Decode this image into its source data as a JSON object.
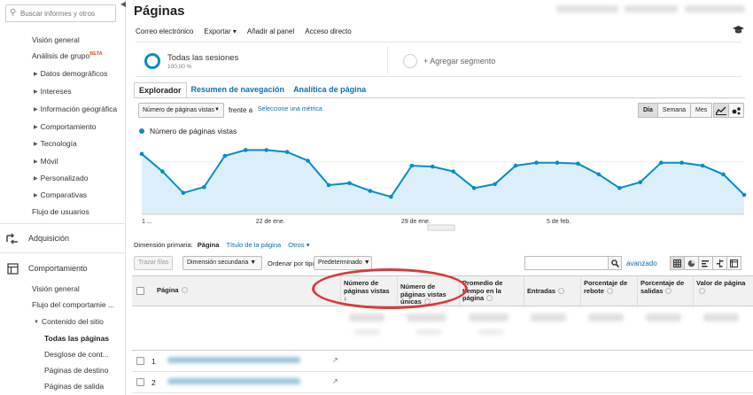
{
  "sidebar": {
    "search_placeholder": "Buscar informes y otros",
    "items": [
      {
        "label": "Visión general",
        "indent": 1
      },
      {
        "label": "Análisis de grupo",
        "badge": "BETA",
        "indent": 1
      },
      {
        "label": "Datos demográficos",
        "indent": 2,
        "expandable": true
      },
      {
        "label": "Intereses",
        "indent": 2,
        "expandable": true
      },
      {
        "label": "Información geográfica",
        "indent": 2,
        "expandable": true
      },
      {
        "label": "Comportamiento",
        "indent": 2,
        "expandable": true
      },
      {
        "label": "Tecnología",
        "indent": 2,
        "expandable": true
      },
      {
        "label": "Móvil",
        "indent": 2,
        "expandable": true
      },
      {
        "label": "Personalizado",
        "indent": 2,
        "expandable": true
      },
      {
        "label": "Comparativas",
        "indent": 2,
        "expandable": true
      },
      {
        "label": "Flujo de usuarios",
        "indent": 1
      }
    ],
    "section_adquisicion": "Adquisición",
    "section_comportamiento": "Comportamiento",
    "comportamiento_items": [
      {
        "label": "Visión general"
      },
      {
        "label": "Flujo del comportamie ..."
      },
      {
        "label": "Contenido del sitio",
        "expanded": true
      },
      {
        "label": "Todas las páginas",
        "active": true
      },
      {
        "label": "Desglose de cont..."
      },
      {
        "label": "Páginas de destino"
      },
      {
        "label": "Páginas de salida"
      }
    ]
  },
  "header": {
    "title": "Páginas",
    "toolbar": [
      "Correo electrónico",
      "Exportar",
      "Añadir al panel",
      "Acceso directo"
    ]
  },
  "segments": {
    "all_sessions": "Todas las sesiones",
    "all_sessions_pct": "100,00 %",
    "add_segment": "+ Agregar segmento"
  },
  "tabs": [
    "Explorador",
    "Resumen de navegación",
    "Analítica de página"
  ],
  "controls": {
    "metric": "Número de páginas vistas",
    "vs": "frente a",
    "compare_link": "Seleccione una métrica",
    "periods": [
      "Día",
      "Semana",
      "Mes"
    ],
    "active_period": "Día"
  },
  "chart_data": {
    "type": "area",
    "series": [
      {
        "name": "Número de páginas vistas",
        "values": [
          62,
          44,
          22,
          28,
          60,
          66,
          66,
          64,
          55,
          30,
          32,
          24,
          18,
          50,
          49,
          44,
          27,
          31,
          50,
          53,
          53,
          52,
          41,
          27,
          33,
          53,
          53,
          50,
          41,
          20
        ]
      }
    ],
    "x_tick_labels": [
      "1 ...",
      "22 de ene.",
      "29 de ene.",
      "5 de feb."
    ],
    "color": "#058dc7",
    "fill": "#dbeef9"
  },
  "dimension": {
    "label": "Dimensión primaria:",
    "current": "Página",
    "options": [
      "Título de la página",
      "Otros"
    ]
  },
  "table_controls": {
    "plot_rows": "Trazar filas",
    "secondary": "Dimensión secundaria",
    "sort_label": "Ordenar por tipo:",
    "sort_value": "Predeterminado",
    "advanced": "avanzado"
  },
  "table": {
    "headers": [
      "Página",
      "Número de páginas vistas",
      "Número de páginas vistas únicas",
      "Promedio de tiempo en la página",
      "Entradas",
      "Porcentaje de rebote",
      "Porcentaje de salidas",
      "Valor de página"
    ],
    "rows": [
      "1",
      "2"
    ]
  }
}
